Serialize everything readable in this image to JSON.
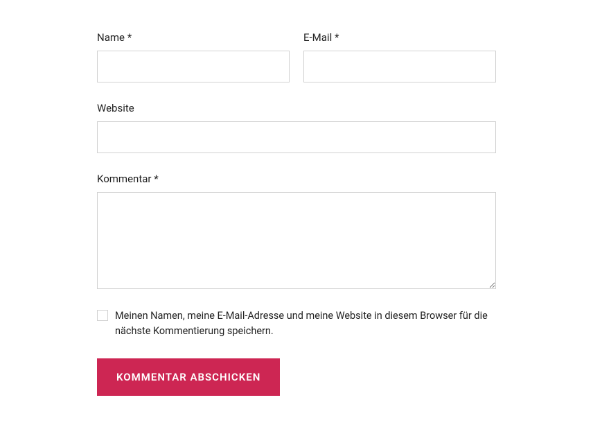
{
  "form": {
    "name_label": "Name ",
    "email_label": "E-Mail ",
    "website_label": "Website",
    "comment_label": "Kommentar ",
    "required_mark": "*",
    "checkbox_label": "Meinen Namen, meine E-Mail-Adresse und meine Website in diesem Browser für die nächste Kommentierung speichern.",
    "submit_label": "Kommentar abschicken"
  }
}
